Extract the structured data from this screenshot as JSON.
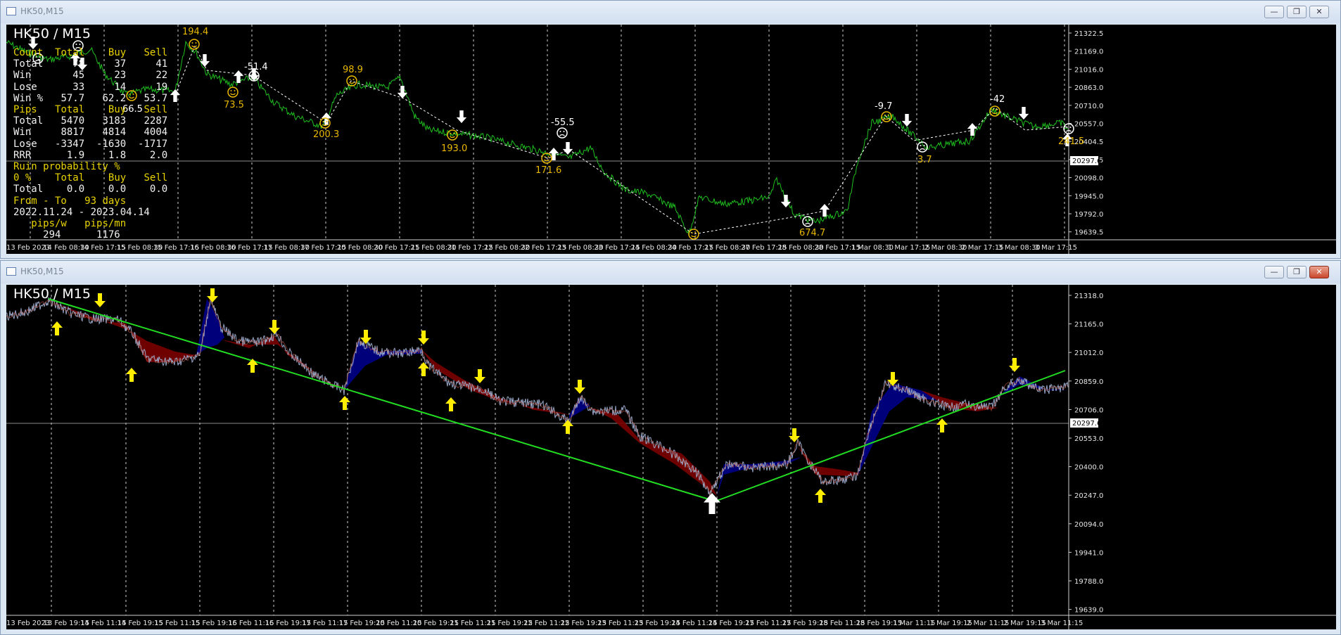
{
  "top_window": {
    "title": "HK50,M15",
    "symbol": "HK50 / M15",
    "y_ticks": [
      "21322.5",
      "21169.0",
      "21016.0",
      "20863.0",
      "20710.0",
      "20557.0",
      "20404.5",
      "20251.5",
      "20098.0",
      "19945.0",
      "19792.0",
      "19639.5"
    ],
    "price_marker": "20297.6",
    "x_ticks": [
      "13 Feb 2023",
      "14 Feb 08:30",
      "14 Feb 17:15",
      "15 Feb 08:30",
      "15 Feb 17:15",
      "16 Feb 08:30",
      "16 Feb 17:15",
      "17 Feb 08:30",
      "17 Feb 17:15",
      "20 Feb 08:30",
      "20 Feb 17:15",
      "21 Feb 08:30",
      "21 Feb 17:15",
      "22 Feb 08:30",
      "22 Feb 17:15",
      "23 Feb 08:30",
      "23 Feb 17:15",
      "24 Feb 08:30",
      "24 Feb 17:15",
      "27 Feb 08:30",
      "27 Feb 17:15",
      "28 Feb 08:30",
      "28 Feb 17:15",
      "1 Mar 08:30",
      "1 Mar 17:15",
      "2 Mar 08:30",
      "2 Mar 17:15",
      "3 Mar 08:30",
      "3 Mar 17:15"
    ],
    "stats": {
      "count": {
        "header": [
          "Count",
          "Total",
          "Buy",
          "Sell"
        ],
        "rows": [
          [
            "Total",
            "78",
            "37",
            "41"
          ],
          [
            "Win",
            "45",
            "23",
            "22"
          ],
          [
            "Lose",
            "33",
            "14",
            "19"
          ],
          [
            "Win %",
            "57.7",
            "62.2",
            "53.7"
          ]
        ]
      },
      "pips": {
        "header": [
          "Pips",
          "Total",
          "Buy",
          "Sell"
        ],
        "rows": [
          [
            "Total",
            "5470",
            "3183",
            "2287"
          ],
          [
            "Win",
            "8817",
            "4814",
            "4004"
          ],
          [
            "Lose",
            "-3347",
            "-1630",
            "-1717"
          ],
          [
            "RRR",
            "1.9",
            "1.8",
            "2.0"
          ]
        ]
      },
      "ruin_title": "Ruin probability %",
      "ruin": {
        "header": [
          "0 %",
          "Total",
          "Buy",
          "Sell"
        ],
        "rows": [
          [
            "Total",
            "0.0",
            "0.0",
            "0.0"
          ]
        ]
      },
      "from_to_label": "From - To",
      "days": "93 days",
      "date_range": "2022.11.24 - 2023.04.14",
      "pips_w_label": "pips/w",
      "pips_m_label": "pips/mn",
      "pips_w": "294",
      "pips_m": "1176"
    },
    "trade_labels": [
      {
        "text": "194.4",
        "color": "#e8b800"
      },
      {
        "text": "73.5",
        "color": "#e8b800"
      },
      {
        "text": "-51.4",
        "color": "#ffffff"
      },
      {
        "text": "98.9",
        "color": "#e8b800"
      },
      {
        "text": "200.3",
        "color": "#e8b800"
      },
      {
        "text": "193.0",
        "color": "#e8b800"
      },
      {
        "text": "-55.5",
        "color": "#ffffff"
      },
      {
        "text": "171.6",
        "color": "#e8b800"
      },
      {
        "text": "-22.9",
        "color": "#ffffff"
      },
      {
        "text": "674.7",
        "color": "#e8b800"
      },
      {
        "text": "-9.7",
        "color": "#ffffff"
      },
      {
        "text": "3.7",
        "color": "#e8b800"
      },
      {
        "text": "-42",
        "color": "#ffffff"
      },
      {
        "text": "241.5",
        "color": "#e8b800"
      },
      {
        "text": "66.5",
        "color": "#ffffff"
      }
    ],
    "colors": {
      "price": "#1fbf1f",
      "background": "#000000",
      "grid": "#ffffff",
      "label": "#e8b800"
    }
  },
  "bottom_window": {
    "title": "HK50,M15",
    "symbol": "HK50 / M15",
    "y_ticks": [
      "21318.0",
      "21165.0",
      "21012.0",
      "20859.0",
      "20706.0",
      "20553.0",
      "20400.0",
      "20247.0",
      "20094.0",
      "19941.0",
      "19788.0",
      "19639.0"
    ],
    "price_marker": "20297.6",
    "x_ticks": [
      "13 Feb 2023",
      "13 Feb 19:15",
      "14 Feb 11:15",
      "14 Feb 19:15",
      "15 Feb 11:15",
      "15 Feb 19:15",
      "16 Feb 11:15",
      "16 Feb 19:15",
      "17 Feb 11:15",
      "17 Feb 19:15",
      "20 Feb 11:15",
      "20 Feb 19:15",
      "21 Feb 11:15",
      "21 Feb 19:15",
      "22 Feb 11:15",
      "22 Feb 19:15",
      "23 Feb 11:15",
      "23 Feb 19:15",
      "24 Feb 11:15",
      "24 Feb 19:15",
      "27 Feb 11:15",
      "27 Feb 19:15",
      "28 Feb 11:15",
      "28 Feb 19:15",
      "1 Mar 11:15",
      "1 Mar 19:15",
      "2 Mar 11:15",
      "2 Mar 19:15",
      "3 Mar 11:15"
    ],
    "colors": {
      "trendline": "#22dd22",
      "bull_cloud": "#000088",
      "bear_cloud": "#7a0000",
      "arrow": "#ffee00",
      "candles": "#9aa8c8"
    }
  }
}
